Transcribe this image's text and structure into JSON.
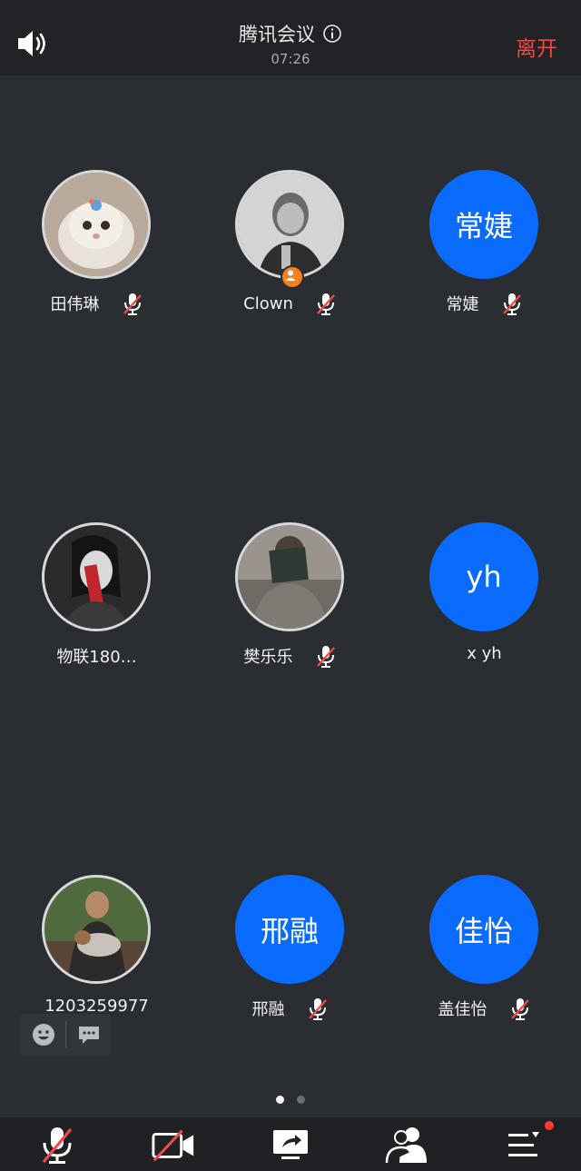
{
  "header": {
    "title": "腾讯会议",
    "timer": "07:26",
    "leave_label": "离开"
  },
  "participants": [
    {
      "name": "田伟琳",
      "avatar_type": "photo",
      "avatar_text": "",
      "muted": true,
      "host": false
    },
    {
      "name": "Clown",
      "avatar_type": "photo",
      "avatar_text": "",
      "muted": true,
      "host": true
    },
    {
      "name": "常婕",
      "avatar_type": "text",
      "avatar_text": "常婕",
      "muted": true,
      "host": false
    },
    {
      "name": "物联180…",
      "avatar_type": "photo",
      "avatar_text": "",
      "muted": false,
      "host": false
    },
    {
      "name": "樊乐乐",
      "avatar_type": "photo",
      "avatar_text": "",
      "muted": true,
      "host": false
    },
    {
      "name": "x yh",
      "avatar_type": "text",
      "avatar_text": "yh",
      "muted": false,
      "host": false
    },
    {
      "name": "1203259977",
      "avatar_type": "photo",
      "avatar_text": "",
      "muted": false,
      "host": false
    },
    {
      "name": "邢融",
      "avatar_type": "text",
      "avatar_text": "邢融",
      "muted": true,
      "host": false
    },
    {
      "name": "盖佳怡",
      "avatar_type": "text",
      "avatar_text": "佳怡",
      "muted": true,
      "host": false
    }
  ],
  "pagination": {
    "current": 1,
    "total": 2
  },
  "toolbar": {
    "icons": [
      "mic-muted-icon",
      "camera-off-icon",
      "screen-share-icon",
      "participants-icon",
      "more-menu-icon"
    ],
    "has_notification": true
  },
  "colors": {
    "accent_blue": "#0a6cff",
    "leave_red": "#ef4a4a",
    "host_orange": "#f5821f",
    "background": "#2a2d31"
  }
}
